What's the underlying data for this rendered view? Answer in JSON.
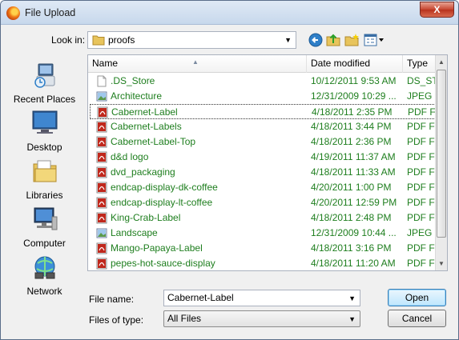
{
  "window": {
    "title": "File Upload",
    "close_label": "X"
  },
  "toolbar": {
    "look_in_label": "Look in:",
    "current_folder": "proofs"
  },
  "places": [
    {
      "name": "recent-places",
      "label": "Recent Places"
    },
    {
      "name": "desktop",
      "label": "Desktop"
    },
    {
      "name": "libraries",
      "label": "Libraries"
    },
    {
      "name": "computer",
      "label": "Computer"
    },
    {
      "name": "network",
      "label": "Network"
    }
  ],
  "columns": {
    "name": "Name",
    "date": "Date modified",
    "type": "Type"
  },
  "files": [
    {
      "name": ".DS_Store",
      "date": "10/12/2011 9:53 AM",
      "type": "DS_STORE",
      "icon": "blank-file-icon"
    },
    {
      "name": "Architecture",
      "date": "12/31/2009 10:29 ...",
      "type": "JPEG image",
      "icon": "image-file-icon"
    },
    {
      "name": "Cabernet-Label",
      "date": "4/18/2011 2:35 PM",
      "type": "PDF File",
      "icon": "pdf-file-icon"
    },
    {
      "name": "Cabernet-Labels",
      "date": "4/18/2011 3:44 PM",
      "type": "PDF File",
      "icon": "pdf-file-icon"
    },
    {
      "name": "Cabernet-Label-Top",
      "date": "4/18/2011 2:36 PM",
      "type": "PDF File",
      "icon": "pdf-file-icon"
    },
    {
      "name": "d&d logo",
      "date": "4/19/2011 11:37 AM",
      "type": "PDF File",
      "icon": "pdf-file-icon"
    },
    {
      "name": "dvd_packaging",
      "date": "4/18/2011 11:33 AM",
      "type": "PDF File",
      "icon": "pdf-file-icon"
    },
    {
      "name": "endcap-display-dk-coffee",
      "date": "4/20/2011 1:00 PM",
      "type": "PDF File",
      "icon": "pdf-file-icon"
    },
    {
      "name": "endcap-display-lt-coffee",
      "date": "4/20/2011 12:59 PM",
      "type": "PDF File",
      "icon": "pdf-file-icon"
    },
    {
      "name": "King-Crab-Label",
      "date": "4/18/2011 2:48 PM",
      "type": "PDF File",
      "icon": "pdf-file-icon"
    },
    {
      "name": "Landscape",
      "date": "12/31/2009 10:44 ...",
      "type": "JPEG image",
      "icon": "image-file-icon"
    },
    {
      "name": "Mango-Papaya-Label",
      "date": "4/18/2011 3:16 PM",
      "type": "PDF File",
      "icon": "pdf-file-icon"
    },
    {
      "name": "pepes-hot-sauce-display",
      "date": "4/18/2011 11:20 AM",
      "type": "PDF File",
      "icon": "pdf-file-icon"
    }
  ],
  "selected_index": 2,
  "footer": {
    "file_name_label": "File name:",
    "file_name_value": "Cabernet-Label",
    "files_of_type_label": "Files of type:",
    "files_of_type_value": "All Files",
    "open_label": "Open",
    "cancel_label": "Cancel"
  },
  "colors": {
    "file_text": "#1e7e1e",
    "pdf_red": "#c0281c",
    "accent": "#3c7fb1"
  }
}
